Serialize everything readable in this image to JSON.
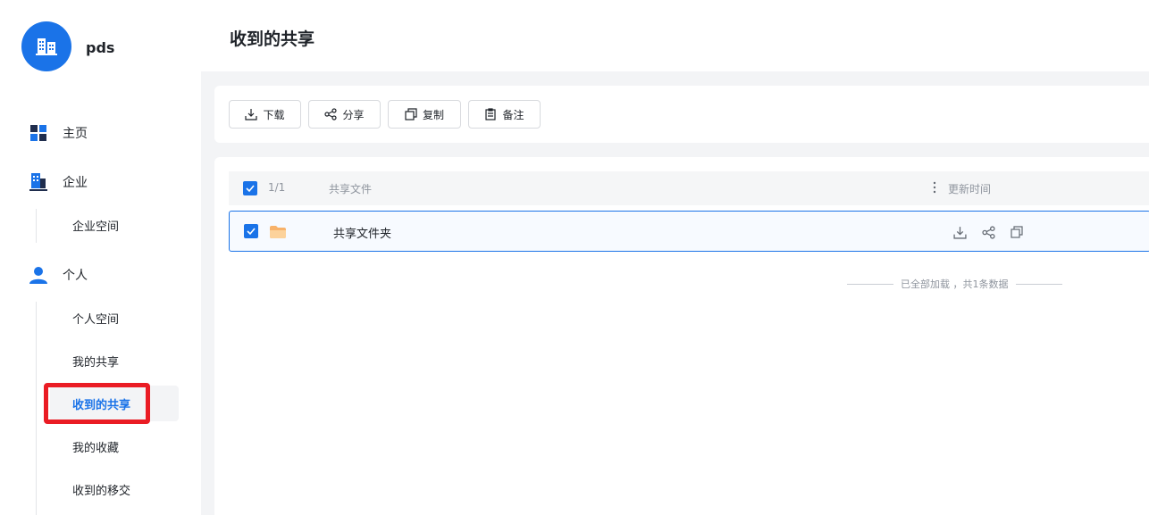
{
  "app": {
    "name": "pds"
  },
  "sidebar": {
    "items": [
      {
        "label": "主页",
        "icon": "dashboard-icon"
      },
      {
        "label": "企业",
        "icon": "building-icon",
        "children": [
          {
            "label": "企业空间"
          }
        ]
      },
      {
        "label": "个人",
        "icon": "user-icon",
        "children": [
          {
            "label": "个人空间"
          },
          {
            "label": "我的共享"
          },
          {
            "label": "收到的共享",
            "active": true
          },
          {
            "label": "我的收藏"
          },
          {
            "label": "收到的移交"
          }
        ]
      }
    ]
  },
  "header": {
    "title": "收到的共享"
  },
  "toolbar": {
    "download": "下载",
    "share": "分享",
    "copy": "复制",
    "note": "备注"
  },
  "table": {
    "selection_count": "1/1",
    "columns": {
      "file": "共享文件",
      "time": "更新时间"
    },
    "rows": [
      {
        "name": "共享文件夹",
        "updated": "",
        "selected": true
      }
    ],
    "footer": "已全部加载 ，共1条数据"
  },
  "colors": {
    "accent": "#1a73e8",
    "highlight": "#ea1c24",
    "folder": "#f8b26a"
  }
}
